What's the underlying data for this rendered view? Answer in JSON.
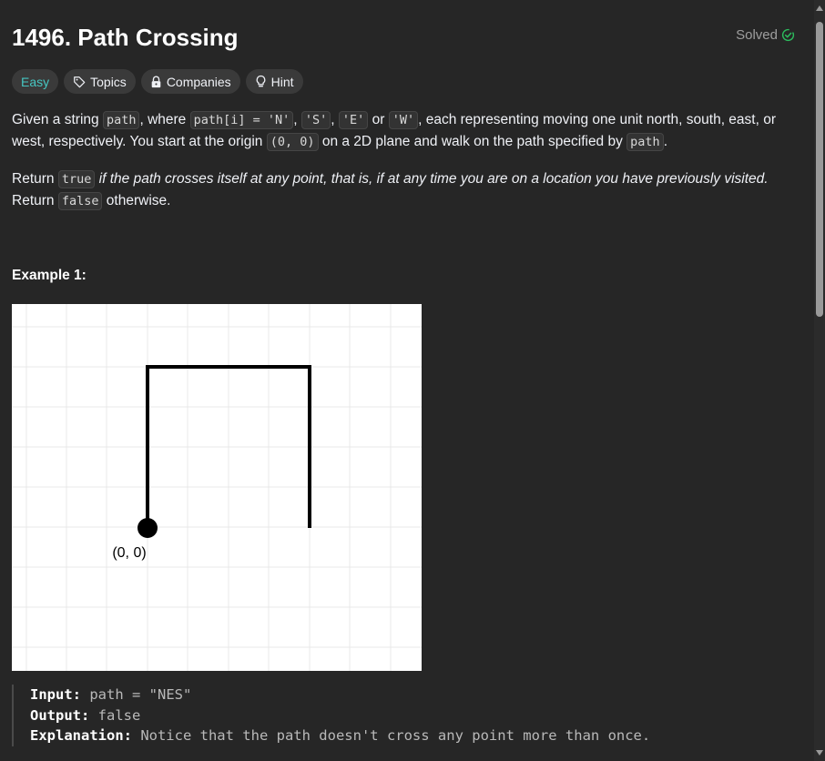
{
  "problem": {
    "title": "1496. Path Crossing",
    "status": "Solved",
    "status_color": "#2cbb5d"
  },
  "tags": {
    "difficulty": "Easy",
    "topics": "Topics",
    "companies": "Companies",
    "hint": "Hint"
  },
  "description": {
    "p1_t1": "Given a string ",
    "p1_c1": "path",
    "p1_t2": ", where ",
    "p1_c2": "path[i] = 'N'",
    "p1_t3": ", ",
    "p1_c3": "'S'",
    "p1_t4": ", ",
    "p1_c4": "'E'",
    "p1_t5": " or ",
    "p1_c5": "'W'",
    "p1_t6": ", each representing moving one unit north, south, east, or west, respectively. You start at the origin ",
    "p1_c6": "(0, 0)",
    "p1_t7": " on a 2D plane and walk on the path specified by ",
    "p1_c7": "path",
    "p1_t8": ".",
    "p2_t1": "Return ",
    "p2_c1": "true",
    "p2_em": " if the path crosses itself at any point, that is, if at any time you are on a location you have previously visited.",
    "p2_t2": " Return ",
    "p2_c2": "false",
    "p2_t3": " otherwise."
  },
  "example": {
    "title": "Example 1:",
    "origin_label": "(0, 0)",
    "input_label": "Input:",
    "input_value": " path = \"NES\"",
    "output_label": "Output:",
    "output_value": " false",
    "explanation_label": "Explanation:",
    "explanation_value": " Notice that the path doesn't cross any point more than once."
  }
}
